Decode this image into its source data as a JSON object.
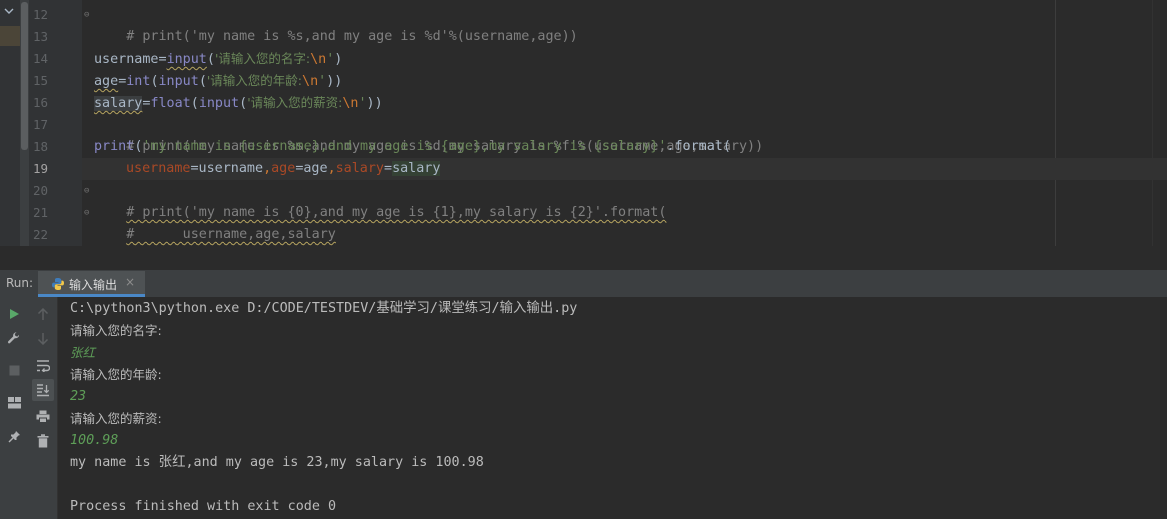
{
  "editor": {
    "line_numbers": [
      "12",
      "13",
      "14",
      "15",
      "16",
      "17",
      "18",
      "19",
      "20",
      "21",
      "22"
    ],
    "active_line": "19",
    "lines": {
      "l12": "# print('my name is %s,and my age is %d'%(username,age))",
      "l14a": "username",
      "l14b": "=",
      "l14c": "input",
      "l14d": "(",
      "l14e": "'请输入您的名字:",
      "l14f": "\\n",
      "l14g": "'",
      "l14h": ")",
      "l15a": "age",
      "l15b": "=",
      "l15c": "int",
      "l15d": "(",
      "l15e": "input",
      "l15f": "(",
      "l15g": "'请输入您的年龄:",
      "l15h": "\\n",
      "l15i": "'",
      "l15j": "))",
      "l16a": "salary",
      "l16b": "=",
      "l16c": "float",
      "l16d": "(",
      "l16e": "input",
      "l16f": "(",
      "l16g": "'请输入您的薪资:",
      "l16h": "\\n",
      "l16i": "'",
      "l16j": "))",
      "l17": "# print('my name is %s,and my age is %d,my salary is %f'%(username,age,salary))",
      "l18a": "print",
      "l18b": "(",
      "l18c": "'my name is {username},and my age is {age},my salary is {salary}'",
      "l18d": ".format(",
      "l19a": "username",
      "l19b": "=username",
      "l19c": ",",
      "l19d": "age",
      "l19e": "=age",
      "l19f": ",",
      "l19g": "salary",
      "l19h": "=",
      "l19i": "salary",
      "l20": "# print('my name is {0},and my age is {1},my salary is {2}'.format(",
      "l21": "#      username,age,salary",
      "l22": "))"
    }
  },
  "run": {
    "label": "Run:",
    "tab_label": "输入输出",
    "tab_close": "×"
  },
  "console": {
    "cmd": "C:\\python3\\python.exe D:/CODE/TESTDEV/基础学习/课堂练习/输入输出.py",
    "prompt_name": "请输入您的名字:",
    "input_name": "张红",
    "prompt_age": "请输入您的年龄:",
    "input_age": "23",
    "prompt_salary": "请输入您的薪资:",
    "input_salary": "100.98",
    "result": "my name is 张红,and my age is 23,my salary is 100.98",
    "exit": "Process finished with exit code 0"
  },
  "colors": {
    "background": "#2b2b2b",
    "keyword": "#cc7832",
    "string": "#6a8759",
    "comment": "#808080",
    "builtin": "#8888c6",
    "named_arg": "#aa4926",
    "user_input": "#5e9e58",
    "run_icon": "#59a869"
  },
  "icons": [
    "chevron-down-icon",
    "python-file-icon",
    "run-icon",
    "wrench-icon",
    "stop-icon",
    "layout-icon",
    "pin-icon",
    "arrow-up-icon",
    "arrow-down-icon",
    "soft-wrap-icon",
    "scroll-to-end-icon",
    "print-icon",
    "trash-icon",
    "close-icon"
  ]
}
